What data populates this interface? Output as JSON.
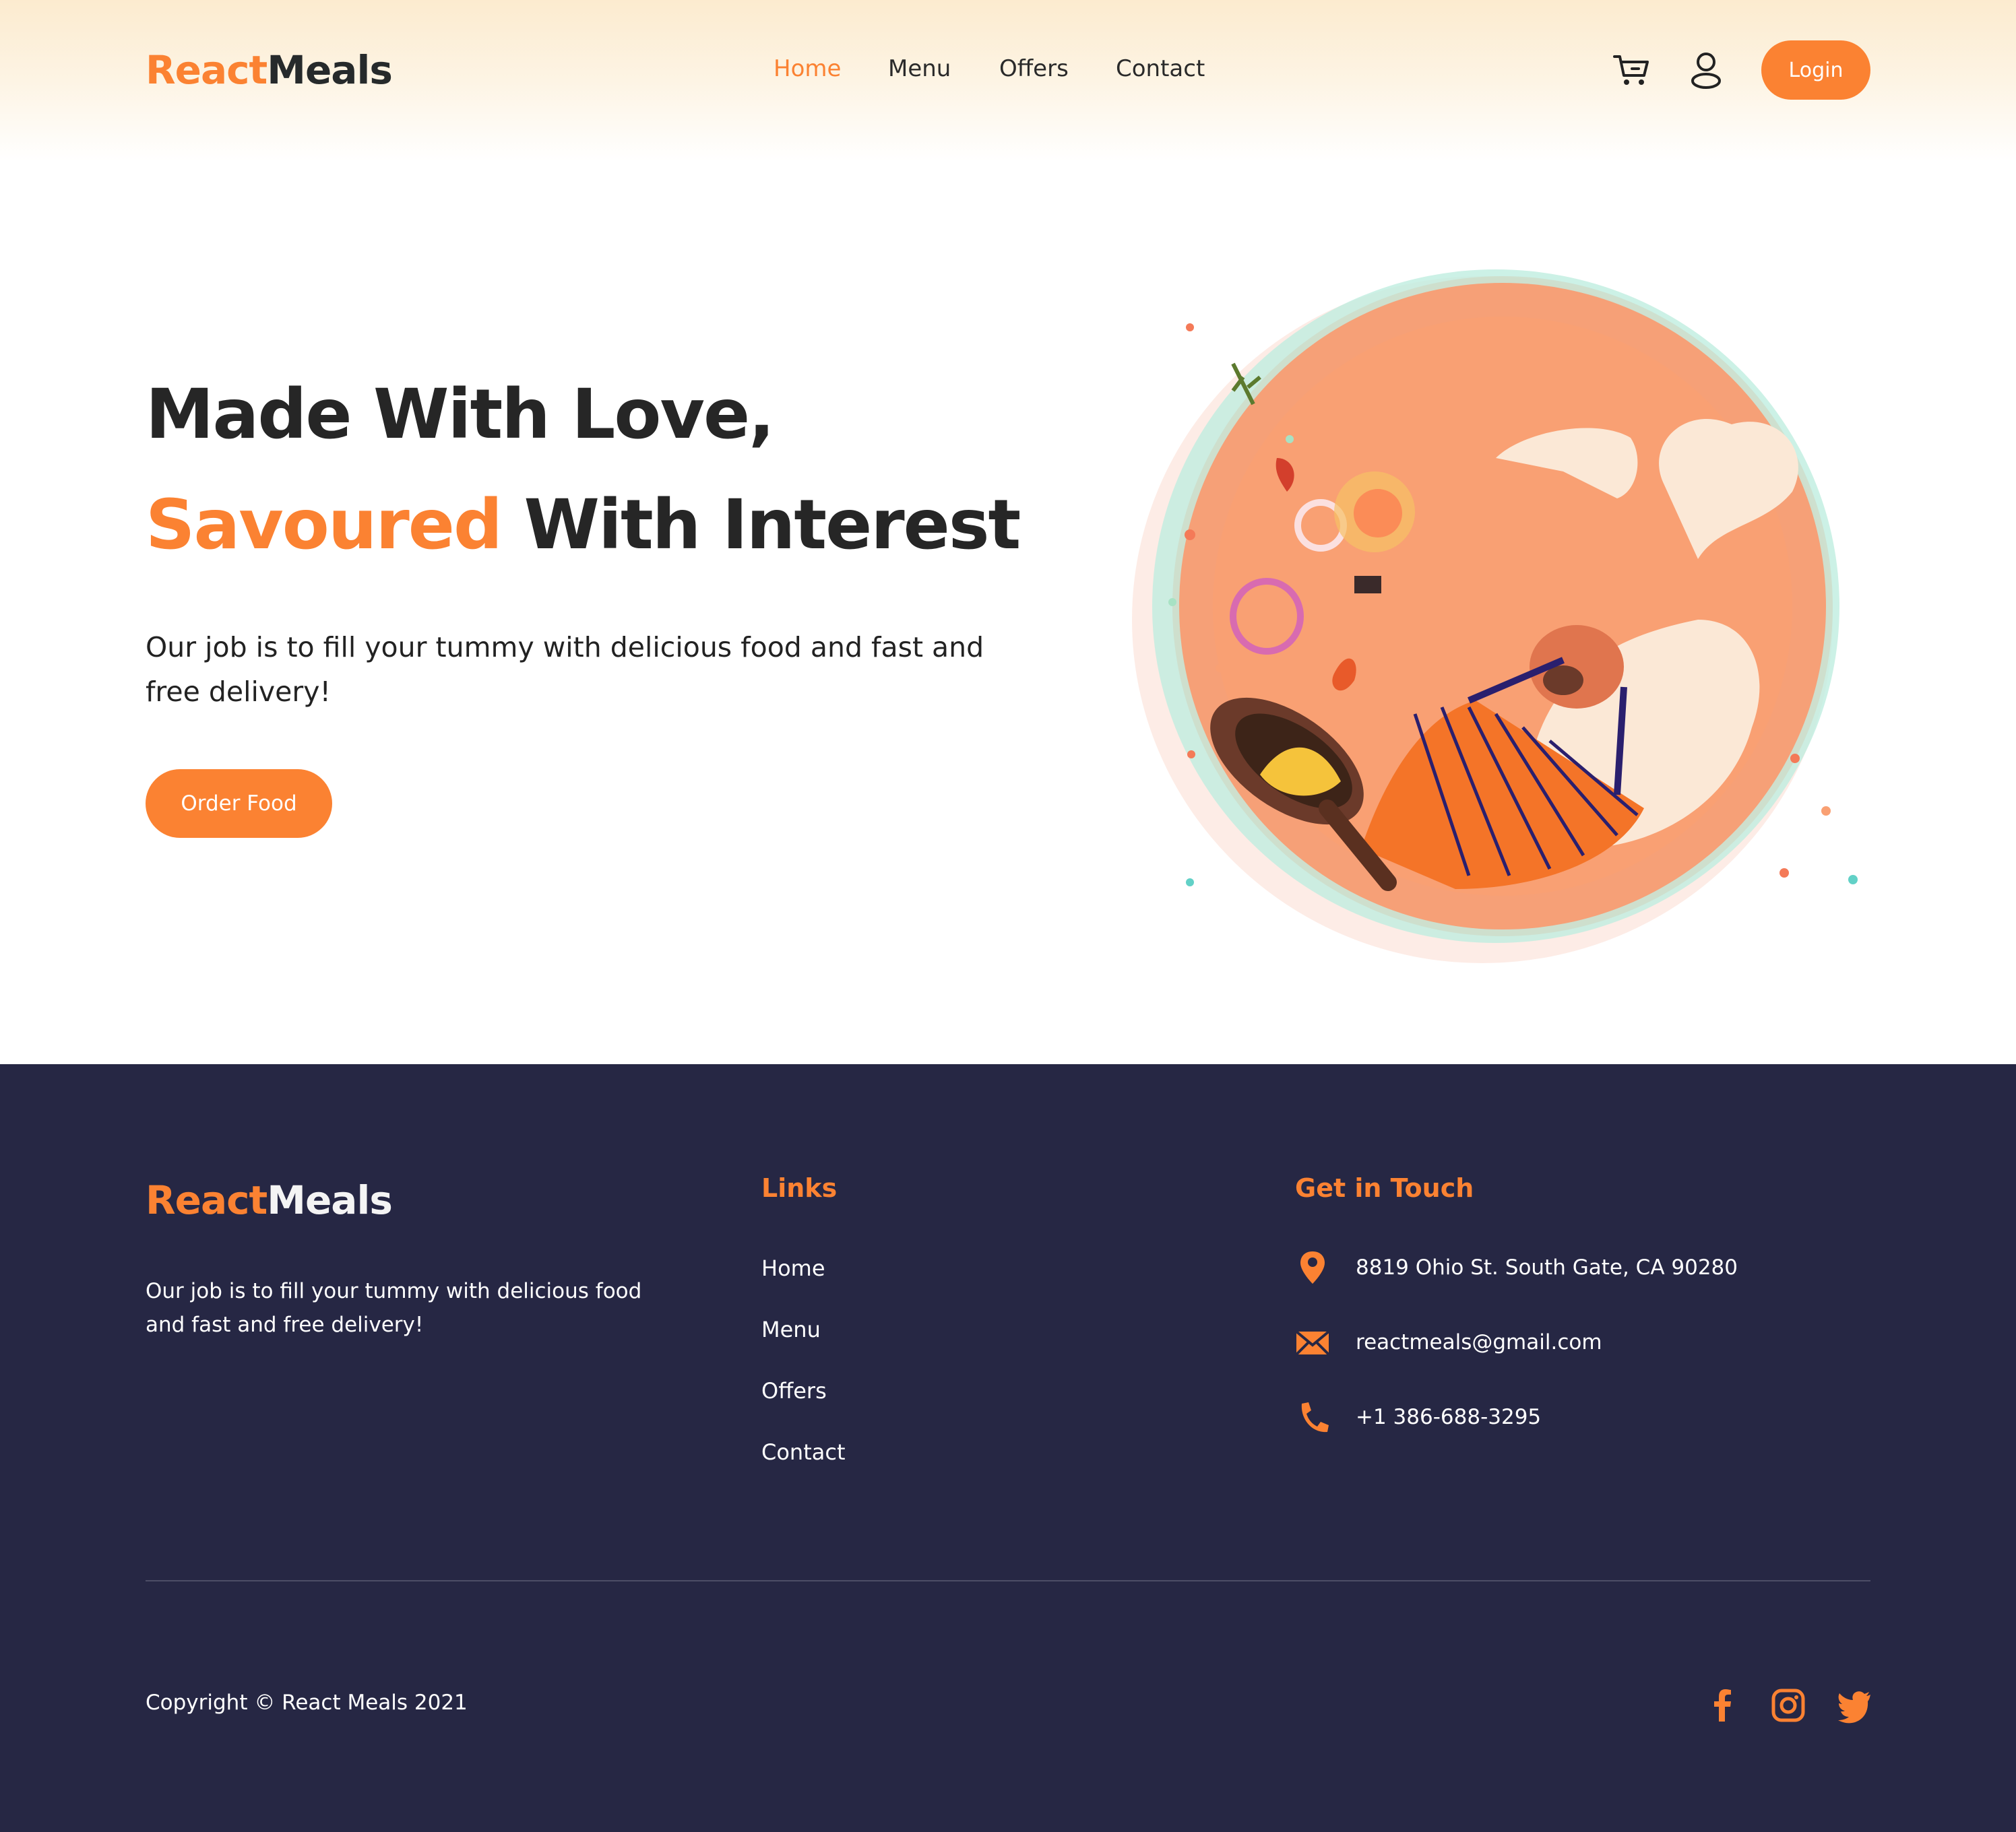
{
  "header": {
    "logo_part1": "React",
    "logo_part2": "Meals",
    "nav": [
      "Home",
      "Menu",
      "Offers",
      "Contact"
    ],
    "active_nav": "Home",
    "cart_icon": "cart-icon",
    "user_icon": "user-icon",
    "login_label": "Login"
  },
  "hero": {
    "title_line1": "Made With Love,",
    "title_highlight": "Savoured",
    "title_rest": " With Interest",
    "text": "Our job is to fill your tummy with delicious food and fast and free delivery!",
    "cta_label": "Order Food"
  },
  "footer": {
    "logo_part1": "React",
    "logo_part2": "Meals",
    "description": "Our job is to fill your tummy with delicious food and fast and free delivery!",
    "links_title": "Links",
    "links": [
      "Home",
      "Menu",
      "Offers",
      "Contact"
    ],
    "contact_title": "Get in Touch",
    "address": "8819 Ohio St. South Gate, CA 90280",
    "email": "reactmeals@gmail.com",
    "phone": "+1 386-688-3295",
    "copyright": "Copyright © React Meals 2021",
    "social_icons": [
      "facebook-icon",
      "instagram-icon",
      "twitter-icon"
    ]
  },
  "colors": {
    "accent": "#fb8232",
    "footer_bg": "#262744",
    "text_dark": "#262626"
  }
}
